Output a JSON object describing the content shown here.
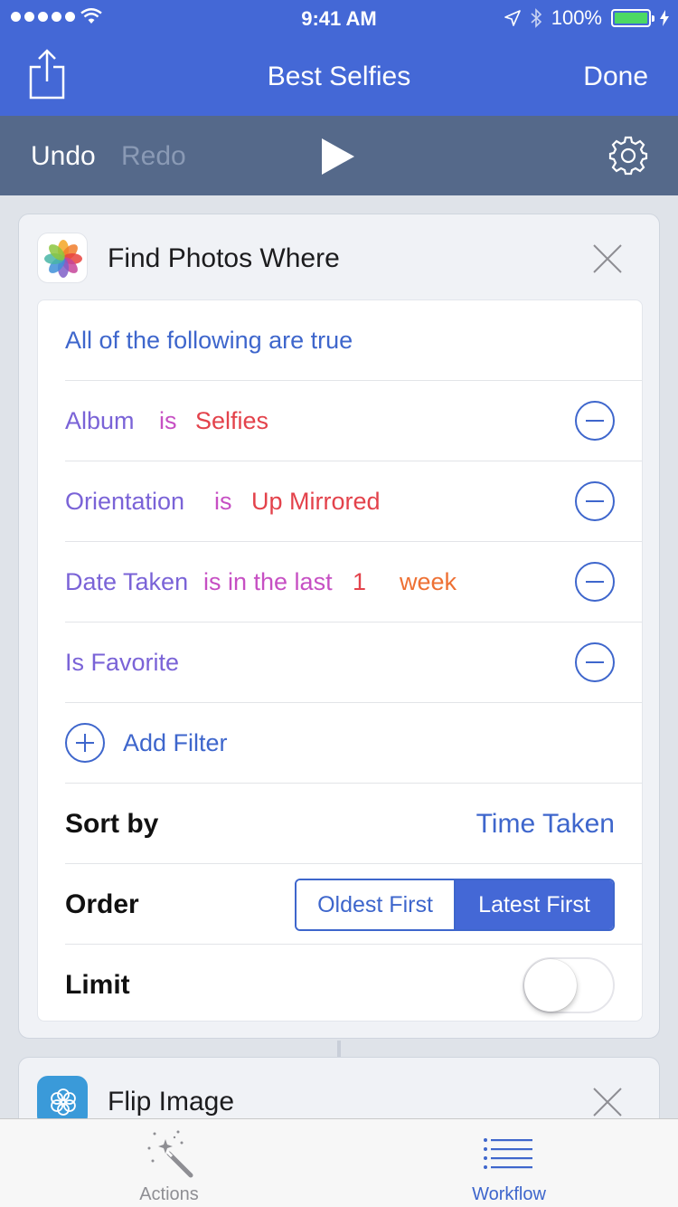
{
  "status_bar": {
    "time": "9:41 AM",
    "battery": "100%"
  },
  "nav": {
    "title": "Best Selfies",
    "done_label": "Done",
    "share_icon": "share-icon"
  },
  "toolbar": {
    "undo_label": "Undo",
    "redo_label": "Redo",
    "play_icon": "play-icon",
    "settings_icon": "gear-icon"
  },
  "find_photos": {
    "title": "Find Photos Where",
    "match_mode": "All of the following are true",
    "filters": [
      {
        "property": "Album",
        "operator": "is",
        "value": "Selfies"
      },
      {
        "property": "Orientation",
        "operator": "is",
        "value": "Up Mirrored"
      },
      {
        "property": "Date Taken",
        "operator": "is in the last",
        "value": "1",
        "unit": "week"
      },
      {
        "property": "Is Favorite"
      }
    ],
    "add_filter_label": "Add Filter",
    "sort_by_label": "Sort by",
    "sort_by_value": "Time Taken",
    "order_label": "Order",
    "order_options": [
      "Oldest First",
      "Latest First"
    ],
    "order_selected": "Latest First",
    "limit_label": "Limit",
    "limit_enabled": false
  },
  "flip_image": {
    "title": "Flip Image"
  },
  "tabbar": {
    "actions_label": "Actions",
    "workflow_label": "Workflow",
    "selected": "Workflow"
  },
  "colors": {
    "nav_bg": "#4468d6",
    "toolbar_bg": "#55698a",
    "accent": "#3e66cc",
    "property": "#7a63d7",
    "operator": "#c64fc3",
    "value": "#e3424b",
    "unit": "#ee7033"
  }
}
